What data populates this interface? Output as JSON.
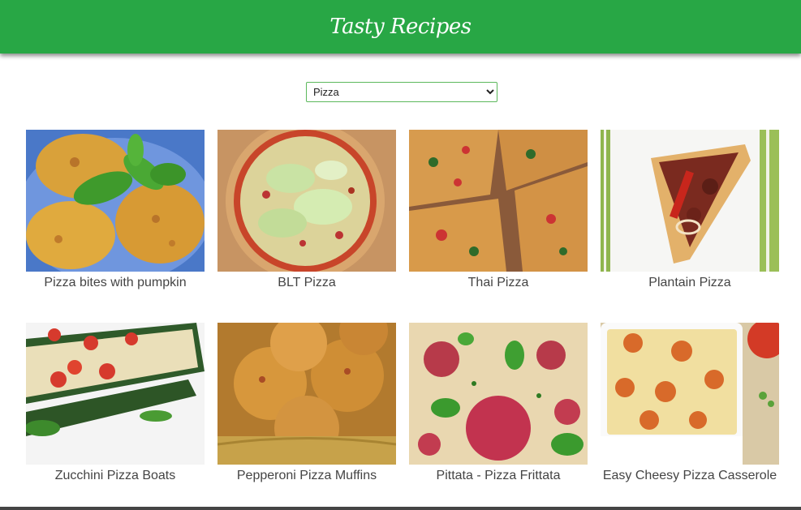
{
  "app": {
    "title": "Tasty Recipes",
    "brand_color": "#28a745"
  },
  "filter": {
    "selected": "Pizza",
    "options": [
      "Pizza"
    ]
  },
  "recipes": [
    {
      "name": "Pizza bites with pumpkin"
    },
    {
      "name": "BLT Pizza"
    },
    {
      "name": "Thai Pizza"
    },
    {
      "name": "Plantain Pizza"
    },
    {
      "name": "Zucchini Pizza Boats"
    },
    {
      "name": "Pepperoni Pizza Muffins"
    },
    {
      "name": "Pittata - Pizza Frittata"
    },
    {
      "name": "Easy Cheesy Pizza Casserole"
    }
  ]
}
